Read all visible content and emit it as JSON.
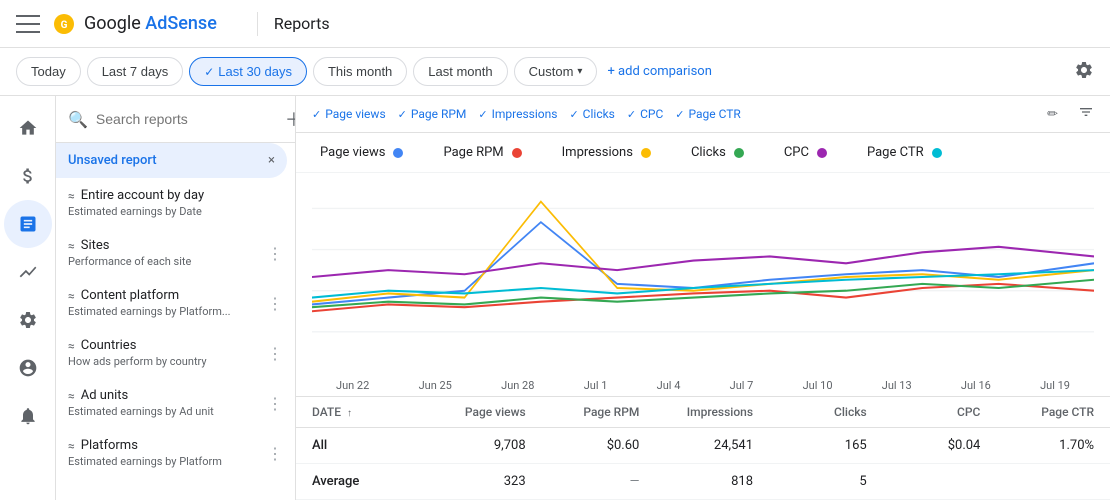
{
  "app": {
    "menu_icon": "☰",
    "logo": "Google AdSense",
    "divider": true,
    "page_title": "Reports"
  },
  "filter_bar": {
    "buttons": [
      {
        "id": "today",
        "label": "Today",
        "active": false
      },
      {
        "id": "last7",
        "label": "Last 7 days",
        "active": false
      },
      {
        "id": "last30",
        "label": "Last 30 days",
        "active": true
      },
      {
        "id": "thismonth",
        "label": "This month",
        "active": false
      },
      {
        "id": "lastmonth",
        "label": "Last month",
        "active": false
      },
      {
        "id": "custom",
        "label": "Custom",
        "active": false,
        "dropdown": true
      }
    ],
    "add_comparison": "+ add comparison",
    "settings_label": "Settings"
  },
  "sidebar": {
    "search_placeholder": "Search reports",
    "add_tooltip": "Add",
    "active_item": {
      "label": "Unsaved report",
      "close": "×"
    },
    "items": [
      {
        "id": "entire-account",
        "name": "Entire account by day",
        "desc": "Estimated earnings by Date",
        "icon": "≈"
      },
      {
        "id": "sites",
        "name": "Sites",
        "desc": "Performance of each site",
        "icon": "≈"
      },
      {
        "id": "content-platform",
        "name": "Content platform",
        "desc": "Estimated earnings by Platform...",
        "icon": "≈"
      },
      {
        "id": "countries",
        "name": "Countries",
        "desc": "How ads perform by country",
        "icon": "≈"
      },
      {
        "id": "ad-units",
        "name": "Ad units",
        "desc": "Estimated earnings by Ad unit",
        "icon": "≈"
      },
      {
        "id": "platforms",
        "name": "Platforms",
        "desc": "Estimated earnings by Platform",
        "icon": "≈"
      }
    ]
  },
  "nav_icons": [
    {
      "id": "home",
      "symbol": "⌂",
      "label": ""
    },
    {
      "id": "earnings",
      "symbol": "$",
      "label": ""
    },
    {
      "id": "reports",
      "symbol": "▦",
      "label": "",
      "active": true
    },
    {
      "id": "optimization",
      "symbol": "~",
      "label": ""
    },
    {
      "id": "settings",
      "symbol": "⚙",
      "label": ""
    },
    {
      "id": "account",
      "symbol": "👤",
      "label": ""
    },
    {
      "id": "alerts",
      "symbol": "🔔",
      "label": ""
    }
  ],
  "metric_tabs": [
    {
      "id": "page-views",
      "label": "Page views",
      "color": "#4285f4"
    },
    {
      "id": "page-rpm",
      "label": "Page RPM",
      "color": "#ea4335"
    },
    {
      "id": "impressions",
      "label": "Impressions",
      "color": "#fbbc04"
    },
    {
      "id": "clicks",
      "label": "Clicks",
      "color": "#34a853"
    },
    {
      "id": "cpc",
      "label": "CPC",
      "color": "#9c27b0"
    },
    {
      "id": "page-ctr",
      "label": "Page CTR",
      "color": "#00bcd4"
    }
  ],
  "chart": {
    "x_labels": [
      "Jun 22",
      "Jun 25",
      "Jun 28",
      "Jul 1",
      "Jul 4",
      "Jul 7",
      "Jul 10",
      "Jul 13",
      "Jul 16",
      "Jul 19"
    ],
    "legend": [
      {
        "label": "Page views",
        "color": "#4285f4"
      },
      {
        "label": "Page RPM",
        "color": "#ea4335"
      },
      {
        "label": "Impressions",
        "color": "#fbbc04"
      },
      {
        "label": "Clicks",
        "color": "#34a853"
      },
      {
        "label": "CPC",
        "color": "#9c27b0"
      },
      {
        "label": "Page CTR",
        "color": "#00bcd4"
      }
    ]
  },
  "table": {
    "headers": [
      {
        "id": "date",
        "label": "DATE",
        "sortable": true,
        "sort_dir": "asc"
      },
      {
        "id": "pageviews",
        "label": "Page views"
      },
      {
        "id": "pagerpm",
        "label": "Page RPM"
      },
      {
        "id": "impressions",
        "label": "Impressions"
      },
      {
        "id": "clicks",
        "label": "Clicks"
      },
      {
        "id": "cpc",
        "label": "CPC"
      },
      {
        "id": "pagectr",
        "label": "Page CTR"
      }
    ],
    "rows": [
      {
        "id": "all-row",
        "date": "All",
        "pageviews": "9,708",
        "pagerpm": "$0.60",
        "impressions": "24,541",
        "clicks": "165",
        "cpc": "$0.04",
        "pagectr": "1.70%"
      },
      {
        "id": "average-row",
        "date": "Average",
        "pageviews": "323",
        "pagerpm": "—",
        "impressions": "818",
        "clicks": "5",
        "cpc": "",
        "pagectr": ""
      }
    ]
  }
}
